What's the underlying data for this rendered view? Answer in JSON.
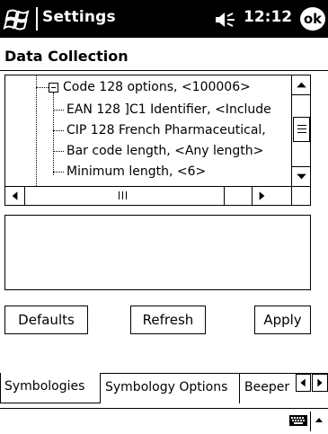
{
  "titlebar": {
    "title": "Settings",
    "time": "12:12",
    "ok_label": "ok"
  },
  "page": {
    "title": "Data Collection"
  },
  "tree": {
    "items": [
      {
        "label": "Code 128 options, <100006>"
      },
      {
        "label": "EAN 128 ]C1 Identifier, <Include"
      },
      {
        "label": "CIP 128 French Pharmaceutical,"
      },
      {
        "label": "Bar code length, <Any length>"
      },
      {
        "label": "Minimum length, <6>"
      }
    ]
  },
  "description": {
    "text": ""
  },
  "buttons": {
    "defaults": {
      "mnemonic": "D",
      "rest": "efaults"
    },
    "refresh": {
      "mnemonic": "R",
      "rest": "efresh"
    },
    "apply": {
      "lead": "",
      "mnemonic": "A",
      "rest": "pply"
    }
  },
  "tabs": [
    {
      "label": "Symbologies",
      "active": true
    },
    {
      "label": "Symbology Options",
      "active": false
    },
    {
      "label": "Beeper",
      "active": false
    }
  ],
  "icons": {
    "start": "windows-flag-icon",
    "volume": "speaker-icon",
    "keyboard": "keyboard-icon",
    "sip": "up-arrow-icon"
  },
  "colors": {
    "titlebar_bg": "#000000",
    "background": "#ffffff"
  }
}
